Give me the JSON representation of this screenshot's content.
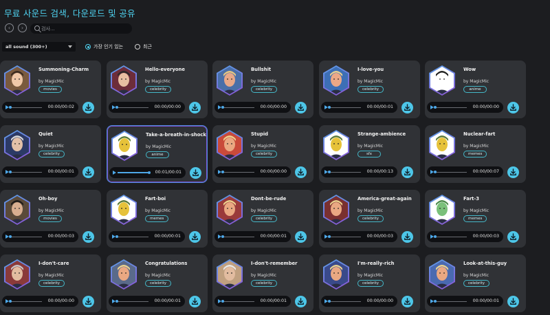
{
  "header": {
    "title": "무료 사운드 검색, 다운로드 및 공유"
  },
  "nav": {
    "back_icon": "‹",
    "forward_icon": "›"
  },
  "search": {
    "placeholder": "검사..."
  },
  "filter": {
    "selected": "all sound (300+)",
    "options": [
      {
        "label": "가장 인기 있는",
        "selected": true
      },
      {
        "label": "최근",
        "selected": false
      }
    ]
  },
  "common": {
    "by": "by MagicMic"
  },
  "colors": {
    "accent": "#4fd4f2",
    "download": "#4dc6e8",
    "card": "#303236",
    "background": "#1c1d20"
  },
  "sounds": [
    {
      "name": "Summoning-Charm",
      "tag": "movies",
      "time": "00:00/00:02",
      "progress": 0,
      "icon": "wizard-boy-avatar",
      "bg": "#7a5a3e",
      "face": "#f0c8a8",
      "hair": "#3a2a1f"
    },
    {
      "name": "Hello-everyone",
      "tag": "celebrity",
      "time": "00:00/00:00",
      "progress": 0,
      "icon": "suit-man-avatar",
      "bg": "#6d2d3a",
      "face": "#e8c0a2",
      "hair": "#2b2a2a"
    },
    {
      "name": "Bullshit",
      "tag": "celebrity",
      "time": "00:00/00:00",
      "progress": 0,
      "icon": "blonde-politician-avatar",
      "bg": "#4a6fa8",
      "face": "#e8a888",
      "hair": "#e8c880"
    },
    {
      "name": "I-love-you",
      "tag": "celebrity",
      "time": "00:00/00:01",
      "progress": 0,
      "icon": "blonde-politician-avatar",
      "bg": "#3d6fb5",
      "face": "#eca886",
      "hair": "#ead08f"
    },
    {
      "name": "Wow",
      "tag": "anime",
      "time": "00:00/00:00",
      "progress": 0,
      "icon": "speech-bubble-avatar",
      "bg": "#ffffff",
      "face": "#ffffff",
      "hair": "#222222"
    },
    {
      "name": "Quiet",
      "tag": "celebrity",
      "time": "00:00/00:01",
      "progress": 0,
      "icon": "suit-man-avatar",
      "bg": "#2c3a66",
      "face": "#e2c0a8",
      "hair": "#d8d8d8"
    },
    {
      "name": "Take-a-breath-in-shock",
      "tag": "anime",
      "time": "00:01/00:01",
      "progress": 1,
      "icon": "cartoon-meme-avatar",
      "bg": "#ffffff",
      "face": "#e6c23a",
      "hair": "#5a7a3a",
      "active": true
    },
    {
      "name": "Stupid",
      "tag": "celebrity",
      "time": "00:00/00:00",
      "progress": 0,
      "icon": "blonde-politician-avatar",
      "bg": "#c94a3a",
      "face": "#eaa882",
      "hair": "#ecd28e"
    },
    {
      "name": "Strange-ambience",
      "tag": "sfx",
      "time": "00:00/00:13",
      "progress": 0,
      "icon": "cartoon-meme-avatar",
      "bg": "#ffffff",
      "face": "#e6c23a",
      "hair": "#5a7a3a"
    },
    {
      "name": "Nuclear-fart",
      "tag": "memes",
      "time": "00:00/00:07",
      "progress": 0,
      "icon": "cartoon-meme-avatar",
      "bg": "#ffffff",
      "face": "#e6c23a",
      "hair": "#5a7a3a"
    },
    {
      "name": "Oh-boy",
      "tag": "movies",
      "time": "00:00/00:03",
      "progress": 0,
      "icon": "dark-hair-avatar",
      "bg": "#5a4a3a",
      "face": "#d8ae90",
      "hair": "#1e1a18"
    },
    {
      "name": "Fart-boi",
      "tag": "memes",
      "time": "00:00/00:01",
      "progress": 0,
      "icon": "cartoon-meme-avatar",
      "bg": "#ffffff",
      "face": "#e6c23a",
      "hair": "#5a7a3a"
    },
    {
      "name": "Dont-be-rude",
      "tag": "celebrity",
      "time": "00:00/00:01",
      "progress": 0,
      "icon": "blonde-politician-avatar",
      "bg": "#9a3a3a",
      "face": "#eaa882",
      "hair": "#ecd28e"
    },
    {
      "name": "America-great-again",
      "tag": "celebrity",
      "time": "00:00/00:03",
      "progress": 0,
      "icon": "blonde-politician-avatar",
      "bg": "#7a3030",
      "face": "#eaa882",
      "hair": "#ecd28e"
    },
    {
      "name": "Fart-3",
      "tag": "memes",
      "time": "00:00/00:03",
      "progress": 0,
      "icon": "cartoon-figure-avatar",
      "bg": "#ffffff",
      "face": "#7ac07a",
      "hair": "#4a8a4a"
    },
    {
      "name": "I-don't-care",
      "tag": "celebrity",
      "time": "00:00/00:00",
      "progress": 0,
      "icon": "suit-man-avatar",
      "bg": "#8a3a3a",
      "face": "#e2bca0",
      "hair": "#c8c8c8"
    },
    {
      "name": "Congratulations",
      "tag": "celebrity",
      "time": "00:00/00:01",
      "progress": 0,
      "icon": "blonde-politician-avatar",
      "bg": "#5a6a8a",
      "face": "#eaa882",
      "hair": "#ecd28e"
    },
    {
      "name": "I-don't-remember",
      "tag": "celebrity",
      "time": "00:00/00:01",
      "progress": 0,
      "icon": "suit-man-avatar",
      "bg": "#c0a080",
      "face": "#e2bca0",
      "hair": "#e8e8e8"
    },
    {
      "name": "I'm-really-rich",
      "tag": "celebrity",
      "time": "00:00/00:00",
      "progress": 0,
      "icon": "blonde-politician-avatar",
      "bg": "#3a4a8a",
      "face": "#eaa882",
      "hair": "#ecd28e"
    },
    {
      "name": "Look-at-this-guy",
      "tag": "celebrity",
      "time": "00:00/00:01",
      "progress": 0,
      "icon": "blonde-politician-avatar",
      "bg": "#4a6ab0",
      "face": "#eaa882",
      "hair": "#ecd28e"
    }
  ]
}
